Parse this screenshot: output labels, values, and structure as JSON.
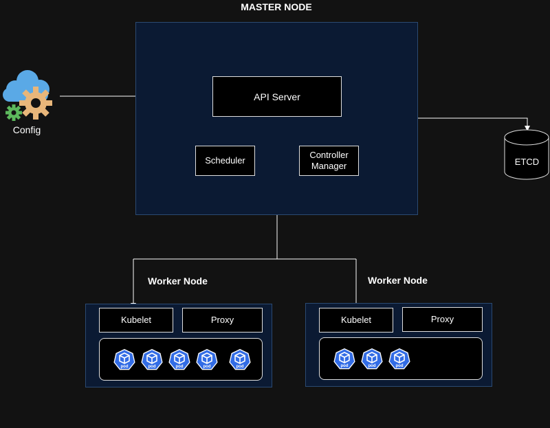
{
  "master": {
    "title": "MASTER NODE",
    "api_server": "API Server",
    "scheduler": "Scheduler",
    "controller_manager_line1": "Controller",
    "controller_manager_line2": "Manager"
  },
  "config": {
    "label": "Config",
    "icon": "cloud-gear-icon"
  },
  "etcd": {
    "label": "ETCD",
    "icon": "database-cylinder-icon"
  },
  "workers": [
    {
      "title": "Worker Node",
      "kubelet": "Kubelet",
      "proxy": "Proxy",
      "pod_count": 5
    },
    {
      "title": "Worker Node",
      "kubelet": "Kubelet",
      "proxy": "Proxy",
      "pod_count": 3
    }
  ],
  "pod_label": "pod",
  "colors": {
    "background": "#121212",
    "panel": "#0b1a33",
    "pod_blue": "#326ce5",
    "cloud_blue": "#5aa9e6",
    "gear_tan": "#e8b67a",
    "gear_green": "#5cb85c"
  }
}
